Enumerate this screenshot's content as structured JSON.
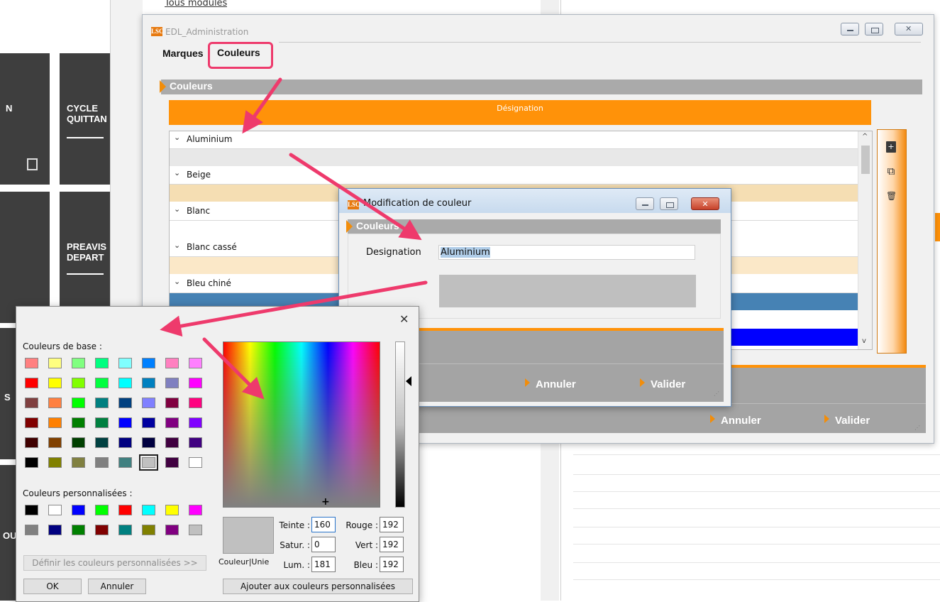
{
  "background": {
    "top_text": "Tous modules",
    "tiles": [
      "N",
      "CYCLE\nQUITTAN",
      "PREAVIS\nDEPART",
      "S",
      "OU"
    ]
  },
  "main_window": {
    "title": "EDL_Administration",
    "logo": "LSC",
    "tabs": [
      "Marques",
      "Couleurs"
    ],
    "active_tab": "Couleurs",
    "section": "Couleurs",
    "column_header": "Désignation",
    "items": [
      {
        "name": "Aluminium",
        "color": "#e8e8e8"
      },
      {
        "name": "Beige",
        "color": "#f5deb3"
      },
      {
        "name": "Blanc",
        "color": "#ffffff"
      },
      {
        "name": "Blanc cassé",
        "color": "#fbe8c8"
      },
      {
        "name": "Bleu chiné",
        "color": "#4682b4"
      },
      {
        "name": "",
        "color": "#0000ff"
      }
    ],
    "tools": [
      {
        "icon": "add-icon",
        "glyph": "+"
      },
      {
        "icon": "copy-icon",
        "glyph": "⧉"
      },
      {
        "icon": "delete-icon",
        "glyph": "🗑"
      }
    ],
    "cancel": "Annuler",
    "validate": "Valider"
  },
  "modif_dialog": {
    "title": "Modification de couleur",
    "logo": "LSC",
    "section": "Couleurs",
    "designation_label": "Designation",
    "designation_value": "Aluminium",
    "close_glyph": "✕",
    "cancel": "Annuler",
    "validate": "Valider"
  },
  "color_picker": {
    "close_glyph": "✕",
    "basic_label": "Couleurs de base :",
    "custom_label": "Couleurs personnalisées :",
    "basic_colors": [
      "#ff8080",
      "#ffff80",
      "#80ff80",
      "#00ff80",
      "#80ffff",
      "#0080ff",
      "#ff80c0",
      "#ff80ff",
      "#ff0000",
      "#ffff00",
      "#80ff00",
      "#00ff40",
      "#00ffff",
      "#0080c0",
      "#8080c0",
      "#ff00ff",
      "#804040",
      "#ff8040",
      "#00ff00",
      "#008080",
      "#004080",
      "#8080ff",
      "#800040",
      "#ff0080",
      "#800000",
      "#ff8000",
      "#008000",
      "#008040",
      "#0000ff",
      "#0000a0",
      "#800080",
      "#8000ff",
      "#400000",
      "#804000",
      "#004000",
      "#004040",
      "#000080",
      "#000040",
      "#400040",
      "#400080",
      "#000000",
      "#808000",
      "#808040",
      "#808080",
      "#408080",
      "#c0c0c0",
      "#400040",
      "#ffffff"
    ],
    "selected_basic_index": 45,
    "custom_colors": [
      "#000000",
      "#ffffff",
      "#0000ff",
      "#00ff00",
      "#ff0000",
      "#00ffff",
      "#ffff00",
      "#ff00ff",
      "#808080",
      "#000080",
      "#008000",
      "#800000",
      "#008080",
      "#808000",
      "#800080",
      "#c0c0c0"
    ],
    "define_custom_button": "Définir les couleurs personnalisées >>",
    "ok_button": "OK",
    "cancel_button": "Annuler",
    "add_custom_button": "Ajouter aux couleurs personnalisées",
    "preview_label": "Couleur|Unie",
    "preview_color": "#c0c0c0",
    "hue_label": "Teinte :",
    "hue_value": "160",
    "sat_label": "Satur. :",
    "sat_value": "0",
    "lum_label": "Lum. :",
    "lum_value": "181",
    "red_label": "Rouge :",
    "red_value": "192",
    "green_label": "Vert :",
    "green_value": "192",
    "blue_label": "Bleu :",
    "blue_value": "192"
  },
  "colors": {
    "accent_orange": "#ff9209",
    "annotation_pink": "#ee3a6c",
    "section_grey": "#aaaaaa"
  }
}
